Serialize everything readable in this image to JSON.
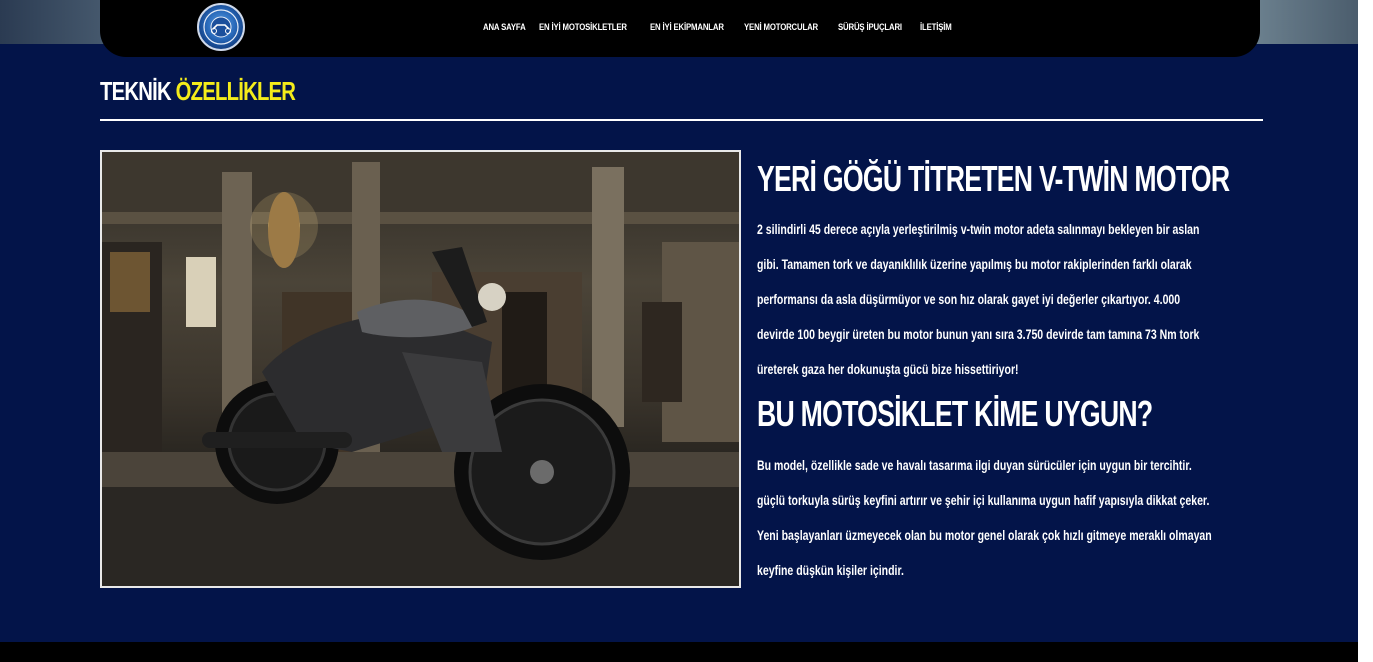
{
  "nav": {
    "logo_icon": "motorcycle-club-badge",
    "links": [
      "ANA SAYFA",
      "EN İYİ MOTOSİKLETLER",
      "EN İYİ EKİPMANLAR",
      "YENİ MOTORCULAR",
      "SÜRÜŞ İPUÇLARI",
      "İLETİŞİM"
    ]
  },
  "section": {
    "title_white": "TEKNİK ",
    "title_yellow": "ÖZELLİKLER",
    "accent_color": "#f4ec1a",
    "background_color": "#031449"
  },
  "photo": {
    "subject": "motorcycle-photo"
  },
  "content": {
    "heading_1": "YERİ GÖĞÜ TİTRETEN V-TWİN MOTOR",
    "paragraph_1_lines": [
      "2 silindirli 45 derece açıyla yerleştirilmiş v-twin motor adeta salınmayı bekleyen bir aslan",
      "gibi. Tamamen tork ve dayanıklılık üzerine yapılmış bu motor rakiplerinden farklı olarak",
      "performansı da asla düşürmüyor ve son hız olarak gayet iyi değerler çıkartıyor. 4.000",
      "devirde 100 beygir üreten bu motor bunun yanı sıra 3.750 devirde tam tamına 73 Nm tork",
      "üreterek gaza her dokunuşta gücü bize hissettiriyor!"
    ],
    "heading_2": "BU MOTOSİKLET KİME UYGUN?",
    "paragraph_2_lines": [
      "Bu model, özellikle sade ve havalı tasarıma ilgi duyan sürücüler için uygun bir tercihtir.",
      "güçlü torkuyla sürüş keyfini artırır ve şehir içi kullanıma uygun hafif yapısıyla dikkat çeker.",
      "Yeni başlayanları üzmeyecek olan bu motor genel olarak çok hızlı gitmeye meraklı olmayan",
      "keyfine düşkün kişiler içindir."
    ]
  }
}
